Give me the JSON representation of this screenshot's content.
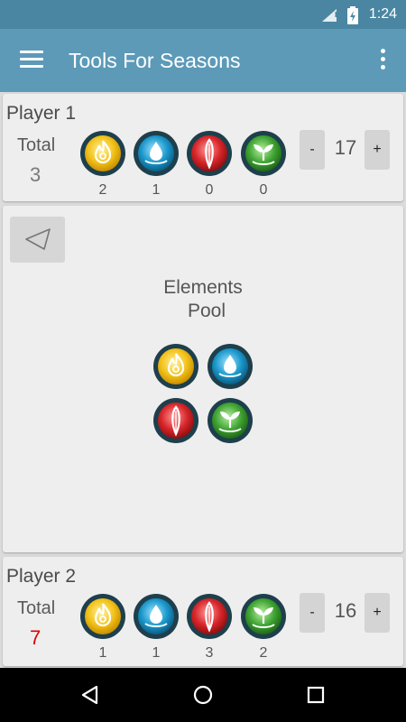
{
  "status_bar": {
    "time": "1:24"
  },
  "app_bar": {
    "title": "Tools For Seasons",
    "menu_icon": "hamburger-icon",
    "more_icon": "overflow-menu-icon"
  },
  "element_colors": {
    "fire": "#f2c21a",
    "water": "#1a98cc",
    "air": "#d8262a",
    "earth": "#3fa332",
    "rim": "#1e3f4c"
  },
  "player1": {
    "name": "Player 1",
    "total_label": "Total",
    "total": "3",
    "counts": {
      "fire": "2",
      "water": "1",
      "air": "0",
      "earth": "0"
    },
    "minus": "-",
    "score": "17",
    "plus": "+"
  },
  "pool": {
    "send_icon": "send-icon",
    "title_line1": "Elements",
    "title_line2": "Pool"
  },
  "player2": {
    "name": "Player 2",
    "total_label": "Total",
    "total": "7",
    "total_color": "#e00000",
    "counts": {
      "fire": "1",
      "water": "1",
      "air": "3",
      "earth": "2"
    },
    "minus": "-",
    "score": "16",
    "plus": "+"
  },
  "nav_bar": {
    "back_icon": "back-icon",
    "home_icon": "home-icon",
    "recents_icon": "recents-icon"
  }
}
